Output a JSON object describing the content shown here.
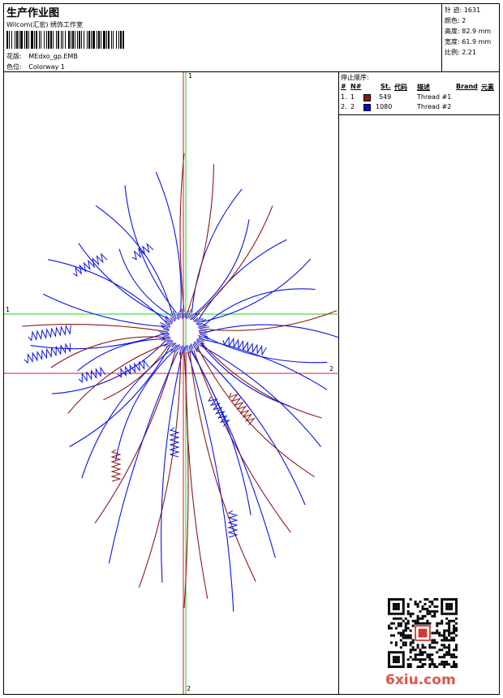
{
  "header": {
    "title": "生产作业图",
    "company": "Wilcom(汇宏) 绣饰工作室",
    "design_label": "花版:",
    "design_file": "MEdxo_gp.EMB",
    "colorway_label": "色位:",
    "colorway": "Colorway 1"
  },
  "stats": [
    {
      "label": "针 迹:",
      "value": "1631"
    },
    {
      "label": "颜色:",
      "value": "2"
    },
    {
      "label": "高度:",
      "value": "82.9 mm"
    },
    {
      "label": "宽度:",
      "value": "61.9 mm"
    },
    {
      "label": "比例:",
      "value": "2.21"
    }
  ],
  "stop_sequence": {
    "title": "停止顺序:",
    "headers": [
      "#",
      "N#",
      "St.",
      "代码",
      "描述",
      "Brand",
      "元素"
    ],
    "rows": [
      {
        "num": "1.",
        "needle": "1",
        "color": "#8b1a1a",
        "stitches": "549",
        "desc": "Thread #1"
      },
      {
        "num": "2.",
        "needle": "2",
        "color": "#0000ee",
        "stitches": "1080",
        "desc": "Thread #2"
      }
    ]
  },
  "guides": {
    "v_top": "1",
    "v_bottom": "2",
    "h_left": "1",
    "h_right": "2"
  },
  "colors": {
    "thread1": "#8b1a1a",
    "thread2": "#0a14e6",
    "guide_green": "#22cc22",
    "guide_red": "#cc2222"
  },
  "watermark": "6xiu.com"
}
